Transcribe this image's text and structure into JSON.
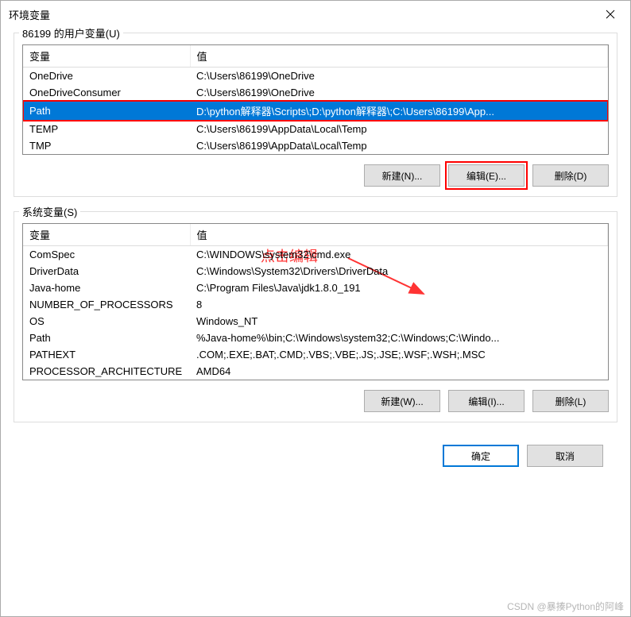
{
  "window": {
    "title": "环境变量"
  },
  "user_group": {
    "label": "86199 的用户变量(U)",
    "columns": {
      "var": "变量",
      "val": "值"
    },
    "rows": [
      {
        "var": "OneDrive",
        "val": "C:\\Users\\86199\\OneDrive",
        "selected": false
      },
      {
        "var": "OneDriveConsumer",
        "val": "C:\\Users\\86199\\OneDrive",
        "selected": false
      },
      {
        "var": "Path",
        "val": "D:\\python解释器\\Scripts\\;D:\\python解释器\\;C:\\Users\\86199\\App...",
        "selected": true
      },
      {
        "var": "TEMP",
        "val": "C:\\Users\\86199\\AppData\\Local\\Temp",
        "selected": false
      },
      {
        "var": "TMP",
        "val": "C:\\Users\\86199\\AppData\\Local\\Temp",
        "selected": false
      }
    ],
    "buttons": {
      "new": "新建(N)...",
      "edit": "编辑(E)...",
      "delete": "删除(D)"
    }
  },
  "system_group": {
    "label": "系统变量(S)",
    "columns": {
      "var": "变量",
      "val": "值"
    },
    "rows": [
      {
        "var": "ComSpec",
        "val": "C:\\WINDOWS\\system32\\cmd.exe"
      },
      {
        "var": "DriverData",
        "val": "C:\\Windows\\System32\\Drivers\\DriverData"
      },
      {
        "var": "Java-home",
        "val": "C:\\Program Files\\Java\\jdk1.8.0_191"
      },
      {
        "var": "NUMBER_OF_PROCESSORS",
        "val": "8"
      },
      {
        "var": "OS",
        "val": "Windows_NT"
      },
      {
        "var": "Path",
        "val": "%Java-home%\\bin;C:\\Windows\\system32;C:\\Windows;C:\\Windo..."
      },
      {
        "var": "PATHEXT",
        "val": ".COM;.EXE;.BAT;.CMD;.VBS;.VBE;.JS;.JSE;.WSF;.WSH;.MSC"
      },
      {
        "var": "PROCESSOR_ARCHITECTURE",
        "val": "AMD64"
      }
    ],
    "buttons": {
      "new": "新建(W)...",
      "edit": "编辑(I)...",
      "delete": "删除(L)"
    }
  },
  "footer": {
    "ok": "确定",
    "cancel": "取消"
  },
  "annotation": {
    "text": "点击编辑"
  },
  "watermark": "CSDN @暴揍Python的阿峰"
}
